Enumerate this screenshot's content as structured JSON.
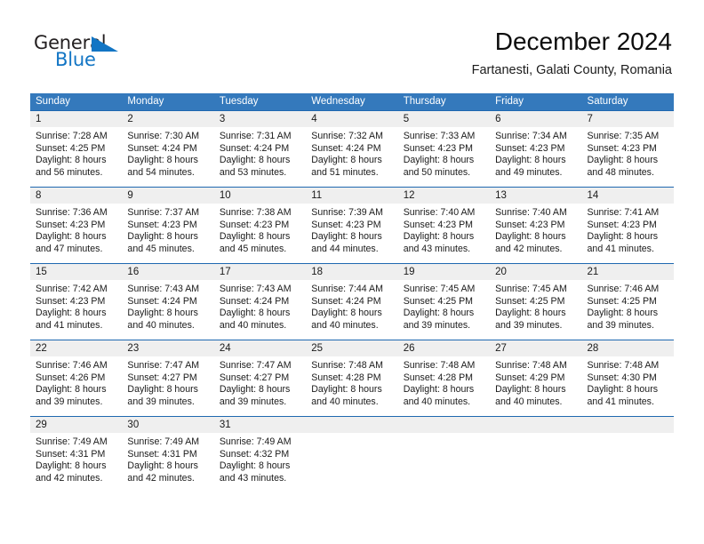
{
  "brand": {
    "name_part1": "General",
    "name_part2": "Blue",
    "flag_color": "#1275c4"
  },
  "header": {
    "title": "December 2024",
    "subtitle": "Fartanesti, Galati County, Romania"
  },
  "theme": {
    "header_blue": "#3479bc",
    "separator_blue": "#1f68b0",
    "daynum_gray": "#efefef",
    "text": "#1a1a1a"
  },
  "weekdays": [
    "Sunday",
    "Monday",
    "Tuesday",
    "Wednesday",
    "Thursday",
    "Friday",
    "Saturday"
  ],
  "weeks": [
    {
      "days": [
        {
          "num": "1",
          "l1": "Sunrise: 7:28 AM",
          "l2": "Sunset: 4:25 PM",
          "l3": "Daylight: 8 hours",
          "l4": "and 56 minutes."
        },
        {
          "num": "2",
          "l1": "Sunrise: 7:30 AM",
          "l2": "Sunset: 4:24 PM",
          "l3": "Daylight: 8 hours",
          "l4": "and 54 minutes."
        },
        {
          "num": "3",
          "l1": "Sunrise: 7:31 AM",
          "l2": "Sunset: 4:24 PM",
          "l3": "Daylight: 8 hours",
          "l4": "and 53 minutes."
        },
        {
          "num": "4",
          "l1": "Sunrise: 7:32 AM",
          "l2": "Sunset: 4:24 PM",
          "l3": "Daylight: 8 hours",
          "l4": "and 51 minutes."
        },
        {
          "num": "5",
          "l1": "Sunrise: 7:33 AM",
          "l2": "Sunset: 4:23 PM",
          "l3": "Daylight: 8 hours",
          "l4": "and 50 minutes."
        },
        {
          "num": "6",
          "l1": "Sunrise: 7:34 AM",
          "l2": "Sunset: 4:23 PM",
          "l3": "Daylight: 8 hours",
          "l4": "and 49 minutes."
        },
        {
          "num": "7",
          "l1": "Sunrise: 7:35 AM",
          "l2": "Sunset: 4:23 PM",
          "l3": "Daylight: 8 hours",
          "l4": "and 48 minutes."
        }
      ]
    },
    {
      "days": [
        {
          "num": "8",
          "l1": "Sunrise: 7:36 AM",
          "l2": "Sunset: 4:23 PM",
          "l3": "Daylight: 8 hours",
          "l4": "and 47 minutes."
        },
        {
          "num": "9",
          "l1": "Sunrise: 7:37 AM",
          "l2": "Sunset: 4:23 PM",
          "l3": "Daylight: 8 hours",
          "l4": "and 45 minutes."
        },
        {
          "num": "10",
          "l1": "Sunrise: 7:38 AM",
          "l2": "Sunset: 4:23 PM",
          "l3": "Daylight: 8 hours",
          "l4": "and 45 minutes."
        },
        {
          "num": "11",
          "l1": "Sunrise: 7:39 AM",
          "l2": "Sunset: 4:23 PM",
          "l3": "Daylight: 8 hours",
          "l4": "and 44 minutes."
        },
        {
          "num": "12",
          "l1": "Sunrise: 7:40 AM",
          "l2": "Sunset: 4:23 PM",
          "l3": "Daylight: 8 hours",
          "l4": "and 43 minutes."
        },
        {
          "num": "13",
          "l1": "Sunrise: 7:40 AM",
          "l2": "Sunset: 4:23 PM",
          "l3": "Daylight: 8 hours",
          "l4": "and 42 minutes."
        },
        {
          "num": "14",
          "l1": "Sunrise: 7:41 AM",
          "l2": "Sunset: 4:23 PM",
          "l3": "Daylight: 8 hours",
          "l4": "and 41 minutes."
        }
      ]
    },
    {
      "days": [
        {
          "num": "15",
          "l1": "Sunrise: 7:42 AM",
          "l2": "Sunset: 4:23 PM",
          "l3": "Daylight: 8 hours",
          "l4": "and 41 minutes."
        },
        {
          "num": "16",
          "l1": "Sunrise: 7:43 AM",
          "l2": "Sunset: 4:24 PM",
          "l3": "Daylight: 8 hours",
          "l4": "and 40 minutes."
        },
        {
          "num": "17",
          "l1": "Sunrise: 7:43 AM",
          "l2": "Sunset: 4:24 PM",
          "l3": "Daylight: 8 hours",
          "l4": "and 40 minutes."
        },
        {
          "num": "18",
          "l1": "Sunrise: 7:44 AM",
          "l2": "Sunset: 4:24 PM",
          "l3": "Daylight: 8 hours",
          "l4": "and 40 minutes."
        },
        {
          "num": "19",
          "l1": "Sunrise: 7:45 AM",
          "l2": "Sunset: 4:25 PM",
          "l3": "Daylight: 8 hours",
          "l4": "and 39 minutes."
        },
        {
          "num": "20",
          "l1": "Sunrise: 7:45 AM",
          "l2": "Sunset: 4:25 PM",
          "l3": "Daylight: 8 hours",
          "l4": "and 39 minutes."
        },
        {
          "num": "21",
          "l1": "Sunrise: 7:46 AM",
          "l2": "Sunset: 4:25 PM",
          "l3": "Daylight: 8 hours",
          "l4": "and 39 minutes."
        }
      ]
    },
    {
      "days": [
        {
          "num": "22",
          "l1": "Sunrise: 7:46 AM",
          "l2": "Sunset: 4:26 PM",
          "l3": "Daylight: 8 hours",
          "l4": "and 39 minutes."
        },
        {
          "num": "23",
          "l1": "Sunrise: 7:47 AM",
          "l2": "Sunset: 4:27 PM",
          "l3": "Daylight: 8 hours",
          "l4": "and 39 minutes."
        },
        {
          "num": "24",
          "l1": "Sunrise: 7:47 AM",
          "l2": "Sunset: 4:27 PM",
          "l3": "Daylight: 8 hours",
          "l4": "and 39 minutes."
        },
        {
          "num": "25",
          "l1": "Sunrise: 7:48 AM",
          "l2": "Sunset: 4:28 PM",
          "l3": "Daylight: 8 hours",
          "l4": "and 40 minutes."
        },
        {
          "num": "26",
          "l1": "Sunrise: 7:48 AM",
          "l2": "Sunset: 4:28 PM",
          "l3": "Daylight: 8 hours",
          "l4": "and 40 minutes."
        },
        {
          "num": "27",
          "l1": "Sunrise: 7:48 AM",
          "l2": "Sunset: 4:29 PM",
          "l3": "Daylight: 8 hours",
          "l4": "and 40 minutes."
        },
        {
          "num": "28",
          "l1": "Sunrise: 7:48 AM",
          "l2": "Sunset: 4:30 PM",
          "l3": "Daylight: 8 hours",
          "l4": "and 41 minutes."
        }
      ]
    },
    {
      "days": [
        {
          "num": "29",
          "l1": "Sunrise: 7:49 AM",
          "l2": "Sunset: 4:31 PM",
          "l3": "Daylight: 8 hours",
          "l4": "and 42 minutes."
        },
        {
          "num": "30",
          "l1": "Sunrise: 7:49 AM",
          "l2": "Sunset: 4:31 PM",
          "l3": "Daylight: 8 hours",
          "l4": "and 42 minutes."
        },
        {
          "num": "31",
          "l1": "Sunrise: 7:49 AM",
          "l2": "Sunset: 4:32 PM",
          "l3": "Daylight: 8 hours",
          "l4": "and 43 minutes."
        },
        {
          "num": "",
          "l1": "",
          "l2": "",
          "l3": "",
          "l4": ""
        },
        {
          "num": "",
          "l1": "",
          "l2": "",
          "l3": "",
          "l4": ""
        },
        {
          "num": "",
          "l1": "",
          "l2": "",
          "l3": "",
          "l4": ""
        },
        {
          "num": "",
          "l1": "",
          "l2": "",
          "l3": "",
          "l4": ""
        }
      ]
    }
  ]
}
